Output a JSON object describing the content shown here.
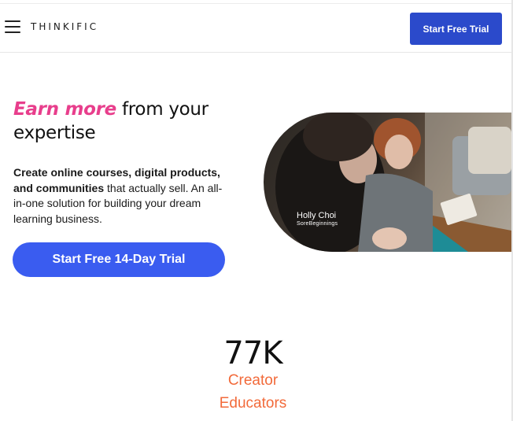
{
  "header": {
    "logo_text": "THINKIFIC",
    "cta_label": "Start Free Trial"
  },
  "hero": {
    "headline_accent": "Earn more",
    "headline_rest": " from your expertise",
    "subtext_bold": "Create online courses, digital products, and communities",
    "subtext_rest": " that actually sell. An all-in-one solution for building your dream learning business.",
    "cta_label": "Start Free 14-Day Trial",
    "image_caption_name": "Holly Choi",
    "image_caption_sub": "SoreBeginnings"
  },
  "stats": {
    "number": "77K",
    "label_line1": "Creator",
    "label_line2": "Educators"
  },
  "colors": {
    "brand_blue": "#2b4acb",
    "cta_blue": "#3a5cf0",
    "accent_pink": "#e83e8c",
    "accent_orange": "#f26a3a"
  },
  "icons": {
    "menu": "hamburger-menu-icon"
  }
}
